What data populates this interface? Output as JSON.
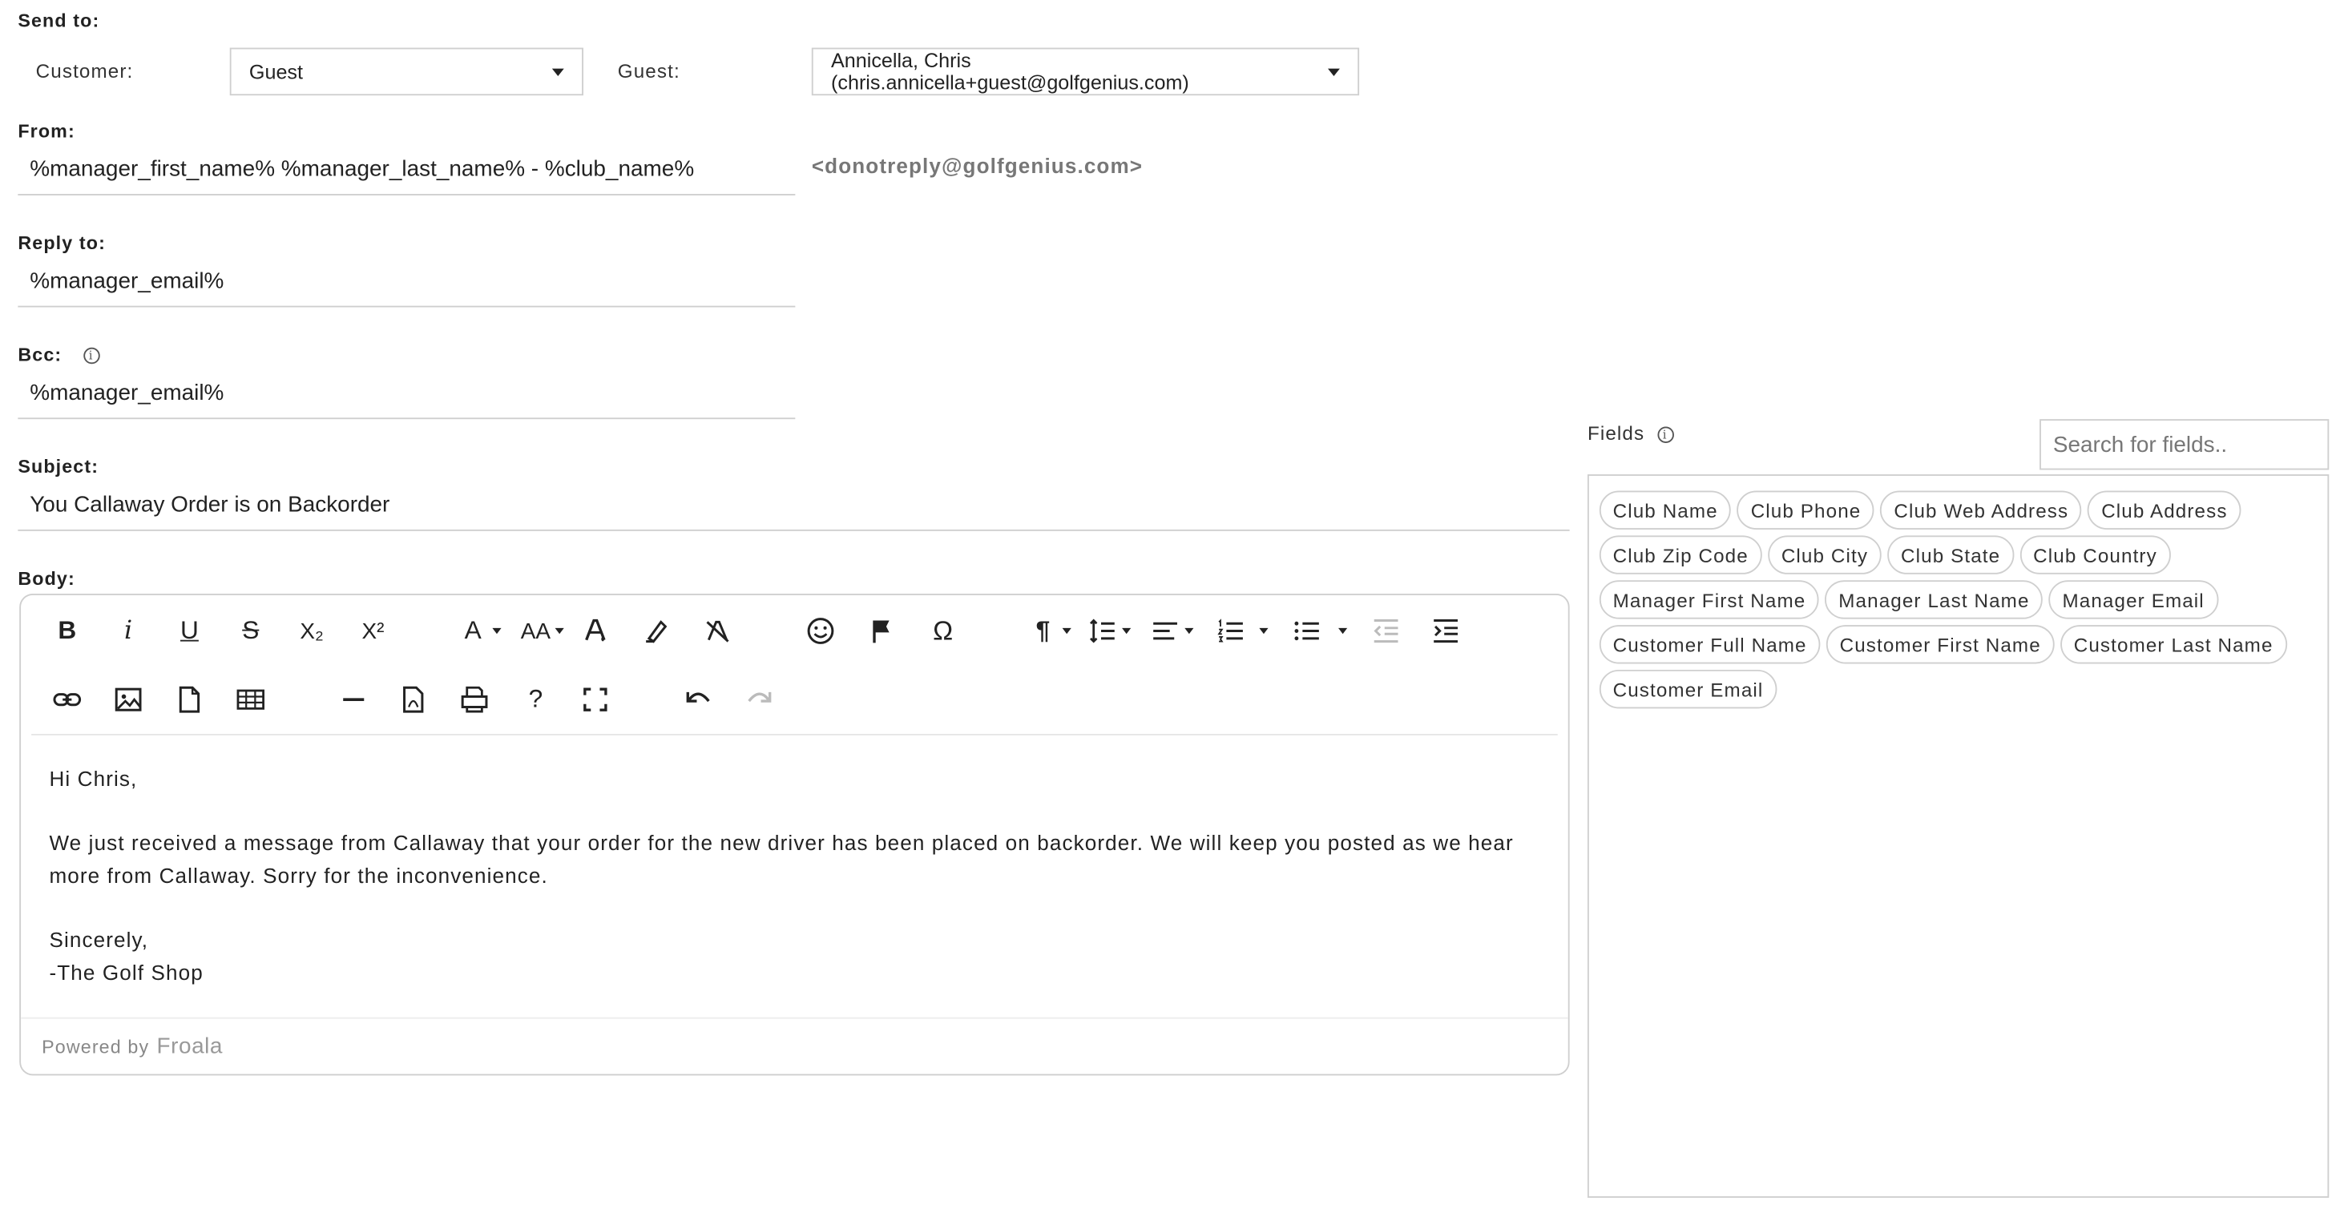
{
  "send_to": {
    "label": "Send to:",
    "customer_label": "Customer:",
    "customer_value": "Guest",
    "guest_label": "Guest:",
    "guest_value": "Annicella, Chris (chris.annicella+guest@golfgenius.com)"
  },
  "from": {
    "label": "From:",
    "value": "%manager_first_name% %manager_last_name% - %club_name%",
    "address": "<donotreply@golfgenius.com>"
  },
  "reply_to": {
    "label": "Reply to:",
    "value": "%manager_email%"
  },
  "bcc": {
    "label": "Bcc:",
    "info_icon": "i",
    "value": "%manager_email%"
  },
  "subject": {
    "label": "Subject:",
    "value": "You Callaway Order is on Backorder"
  },
  "body": {
    "label": "Body:",
    "toolbar_row1": [
      "bold-icon",
      "italic-icon",
      "underline-icon",
      "strikethrough-icon",
      "subscript-icon",
      "superscript-icon",
      "font-family-icon",
      "font-size-icon",
      "text-color-icon",
      "background-color-icon",
      "clear-formatting-icon",
      "emoticons-icon",
      "special-flag-icon",
      "special-characters-icon",
      "paragraph-format-icon",
      "line-height-icon",
      "align-icon",
      "ordered-list-icon",
      "unordered-list-icon",
      "outdent-icon",
      "indent-icon"
    ],
    "toolbar_row2": [
      "insert-link-icon",
      "insert-image-icon",
      "insert-file-icon",
      "insert-table-icon",
      "horizontal-line-icon",
      "pdf-icon",
      "print-icon",
      "help-icon",
      "fullscreen-icon",
      "undo-icon",
      "redo-icon"
    ],
    "glyphs": {
      "bold": "B",
      "italic": "i",
      "underline": "U",
      "strike": "S",
      "subscript": "X₂",
      "superscript": "X²",
      "font": "A",
      "fontsize": "AA",
      "omega": "Ω",
      "pilcrow": "¶",
      "help": "?"
    },
    "greeting": "Hi Chris,",
    "paragraph": "We just received a message from Callaway that your order for the new driver has been placed on backorder. We will keep you posted as we hear more from Callaway. Sorry for the inconvenience.",
    "closing": "Sincerely,",
    "signature": "-The Golf Shop",
    "powered_by": "Powered by",
    "froala": "Froala"
  },
  "fields": {
    "label": "Fields",
    "info_icon": "i",
    "search_placeholder": "Search for fields..",
    "chips": [
      "Club Name",
      "Club Phone",
      "Club Web Address",
      "Club Address",
      "Club Zip Code",
      "Club City",
      "Club State",
      "Club Country",
      "Manager First Name",
      "Manager Last Name",
      "Manager Email",
      "Customer Full Name",
      "Customer First Name",
      "Customer Last Name",
      "Customer Email"
    ]
  },
  "colors": {
    "border": "#cfcfcf",
    "text": "#222222",
    "muted": "#888888",
    "disabled": "#bbbbbb"
  }
}
